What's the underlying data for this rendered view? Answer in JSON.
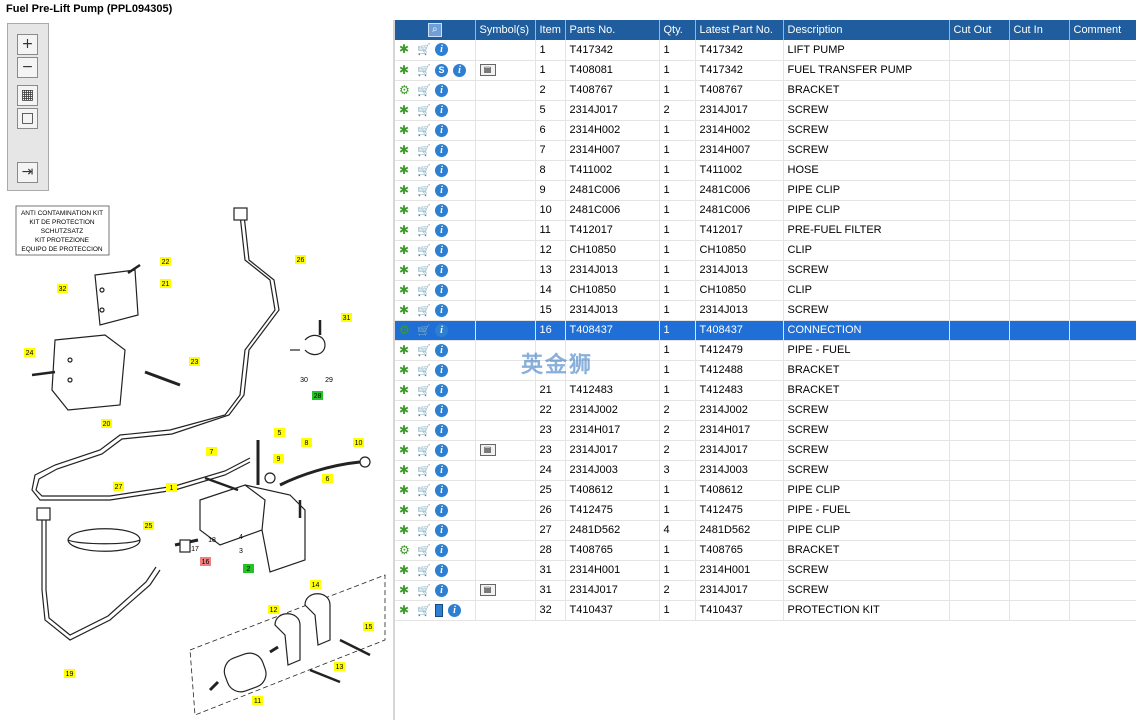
{
  "window": {
    "title": "Fuel Pre-Lift Pump (PPL094305)"
  },
  "watermark": "英金狮",
  "kit_label": {
    "lines": [
      "ANTI CONTAMINATION KIT",
      "KIT DE PROTECTION",
      "SCHUTZSATZ",
      "KIT PROTEZIONE",
      "EQUIPO DE PROTECCION"
    ],
    "number": "32"
  },
  "diagram_callouts": {
    "c22": "22",
    "c21": "21",
    "c26": "26",
    "c31": "31",
    "c24": "24",
    "c23": "23",
    "c30": "30",
    "c29": "29",
    "c28": "28",
    "c20": "20",
    "c5": "5",
    "c8": "8",
    "c10": "10",
    "c7": "7",
    "c9": "9",
    "c27": "27",
    "c1": "1",
    "c6": "6",
    "c25": "25",
    "c4": "4",
    "c3": "3",
    "c2": "2",
    "c18": "18",
    "c17": "17",
    "c16": "16",
    "c15": "15",
    "c14": "14",
    "c12": "12",
    "c13": "13",
    "c11": "11",
    "c19": "19"
  },
  "table": {
    "columns": [
      "",
      "Symbol(s)",
      "Item",
      "Parts No.",
      "Qty.",
      "Latest Part No.",
      "Description",
      "Cut Out",
      "Cut In",
      "Comment"
    ],
    "rows": [
      {
        "icons": [
          "gear",
          "cart",
          "info"
        ],
        "symbol": "",
        "item": "1",
        "part": "T417342",
        "qty": "1",
        "latest": "T417342",
        "desc": "LIFT PUMP"
      },
      {
        "icons": [
          "gear",
          "cart",
          "s",
          "info"
        ],
        "symbol": "book",
        "item": "1",
        "part": "T408081",
        "qty": "1",
        "latest": "T417342",
        "desc": "FUEL TRANSFER PUMP"
      },
      {
        "icons": [
          "gears",
          "cart",
          "info"
        ],
        "symbol": "",
        "item": "2",
        "part": "T408767",
        "qty": "1",
        "latest": "T408767",
        "desc": "BRACKET"
      },
      {
        "icons": [
          "gear",
          "cart",
          "info"
        ],
        "symbol": "",
        "item": "5",
        "part": "2314J017",
        "qty": "2",
        "latest": "2314J017",
        "desc": "SCREW"
      },
      {
        "icons": [
          "gear",
          "cart",
          "info"
        ],
        "symbol": "",
        "item": "6",
        "part": "2314H002",
        "qty": "1",
        "latest": "2314H002",
        "desc": "SCREW"
      },
      {
        "icons": [
          "gear",
          "cart",
          "info"
        ],
        "symbol": "",
        "item": "7",
        "part": "2314H007",
        "qty": "1",
        "latest": "2314H007",
        "desc": "SCREW"
      },
      {
        "icons": [
          "gear",
          "cart",
          "info"
        ],
        "symbol": "",
        "item": "8",
        "part": "T411002",
        "qty": "1",
        "latest": "T411002",
        "desc": "HOSE"
      },
      {
        "icons": [
          "gear",
          "cart",
          "info"
        ],
        "symbol": "",
        "item": "9",
        "part": "2481C006",
        "qty": "1",
        "latest": "2481C006",
        "desc": "PIPE CLIP"
      },
      {
        "icons": [
          "gear",
          "cart",
          "info"
        ],
        "symbol": "",
        "item": "10",
        "part": "2481C006",
        "qty": "1",
        "latest": "2481C006",
        "desc": "PIPE CLIP"
      },
      {
        "icons": [
          "gear",
          "cart",
          "info"
        ],
        "symbol": "",
        "item": "11",
        "part": "T412017",
        "qty": "1",
        "latest": "T412017",
        "desc": "PRE-FUEL FILTER"
      },
      {
        "icons": [
          "gear",
          "cart",
          "info"
        ],
        "symbol": "",
        "item": "12",
        "part": "CH10850",
        "qty": "1",
        "latest": "CH10850",
        "desc": "CLIP"
      },
      {
        "icons": [
          "gear",
          "cart",
          "info"
        ],
        "symbol": "",
        "item": "13",
        "part": "2314J013",
        "qty": "1",
        "latest": "2314J013",
        "desc": "SCREW"
      },
      {
        "icons": [
          "gear",
          "cart",
          "info"
        ],
        "symbol": "",
        "item": "14",
        "part": "CH10850",
        "qty": "1",
        "latest": "CH10850",
        "desc": "CLIP"
      },
      {
        "icons": [
          "gear",
          "cart",
          "info"
        ],
        "symbol": "",
        "item": "15",
        "part": "2314J013",
        "qty": "1",
        "latest": "2314J013",
        "desc": "SCREW"
      },
      {
        "icons": [
          "gears",
          "cart",
          "info"
        ],
        "symbol": "",
        "item": "16",
        "part": "T408437",
        "qty": "1",
        "latest": "T408437",
        "desc": "CONNECTION",
        "selected": true
      },
      {
        "icons": [
          "gear",
          "cart",
          "info"
        ],
        "symbol": "",
        "item": "",
        "part": "",
        "qty": "1",
        "latest": "T412479",
        "desc": "PIPE - FUEL"
      },
      {
        "icons": [
          "gear",
          "cart",
          "info"
        ],
        "symbol": "",
        "item": "",
        "part": "",
        "qty": "1",
        "latest": "T412488",
        "desc": "BRACKET"
      },
      {
        "icons": [
          "gear",
          "cart",
          "info"
        ],
        "symbol": "",
        "item": "21",
        "part": "T412483",
        "qty": "1",
        "latest": "T412483",
        "desc": "BRACKET"
      },
      {
        "icons": [
          "gear",
          "cart",
          "info"
        ],
        "symbol": "",
        "item": "22",
        "part": "2314J002",
        "qty": "2",
        "latest": "2314J002",
        "desc": "SCREW"
      },
      {
        "icons": [
          "gear",
          "cart",
          "info"
        ],
        "symbol": "",
        "item": "23",
        "part": "2314H017",
        "qty": "2",
        "latest": "2314H017",
        "desc": "SCREW"
      },
      {
        "icons": [
          "gear",
          "cart",
          "info"
        ],
        "symbol": "book",
        "item": "23",
        "part": "2314J017",
        "qty": "2",
        "latest": "2314J017",
        "desc": "SCREW"
      },
      {
        "icons": [
          "gear",
          "cart",
          "info"
        ],
        "symbol": "",
        "item": "24",
        "part": "2314J003",
        "qty": "3",
        "latest": "2314J003",
        "desc": "SCREW"
      },
      {
        "icons": [
          "gear",
          "cart",
          "info"
        ],
        "symbol": "",
        "item": "25",
        "part": "T408612",
        "qty": "1",
        "latest": "T408612",
        "desc": "PIPE CLIP"
      },
      {
        "icons": [
          "gear",
          "cart",
          "info"
        ],
        "symbol": "",
        "item": "26",
        "part": "T412475",
        "qty": "1",
        "latest": "T412475",
        "desc": "PIPE - FUEL"
      },
      {
        "icons": [
          "gear",
          "cart",
          "info"
        ],
        "symbol": "",
        "item": "27",
        "part": "2481D562",
        "qty": "4",
        "latest": "2481D562",
        "desc": "PIPE CLIP"
      },
      {
        "icons": [
          "gears",
          "cart",
          "info"
        ],
        "symbol": "",
        "item": "28",
        "part": "T408765",
        "qty": "1",
        "latest": "T408765",
        "desc": "BRACKET"
      },
      {
        "icons": [
          "gear",
          "cart",
          "info"
        ],
        "symbol": "",
        "item": "31",
        "part": "2314H001",
        "qty": "1",
        "latest": "2314H001",
        "desc": "SCREW"
      },
      {
        "icons": [
          "gear",
          "cart",
          "info"
        ],
        "symbol": "book",
        "item": "31",
        "part": "2314J017",
        "qty": "2",
        "latest": "2314J017",
        "desc": "SCREW"
      },
      {
        "icons": [
          "gear",
          "cart",
          "doc",
          "info"
        ],
        "symbol": "",
        "item": "32",
        "part": "T410437",
        "qty": "1",
        "latest": "T410437",
        "desc": "PROTECTION KIT"
      }
    ]
  },
  "colors": {
    "header_bg": "#1f5d9e",
    "selected_row": "#1f6fd6",
    "callout_yellow": "#ffff00",
    "callout_green": "#22c322",
    "callout_red": "#f08080"
  }
}
